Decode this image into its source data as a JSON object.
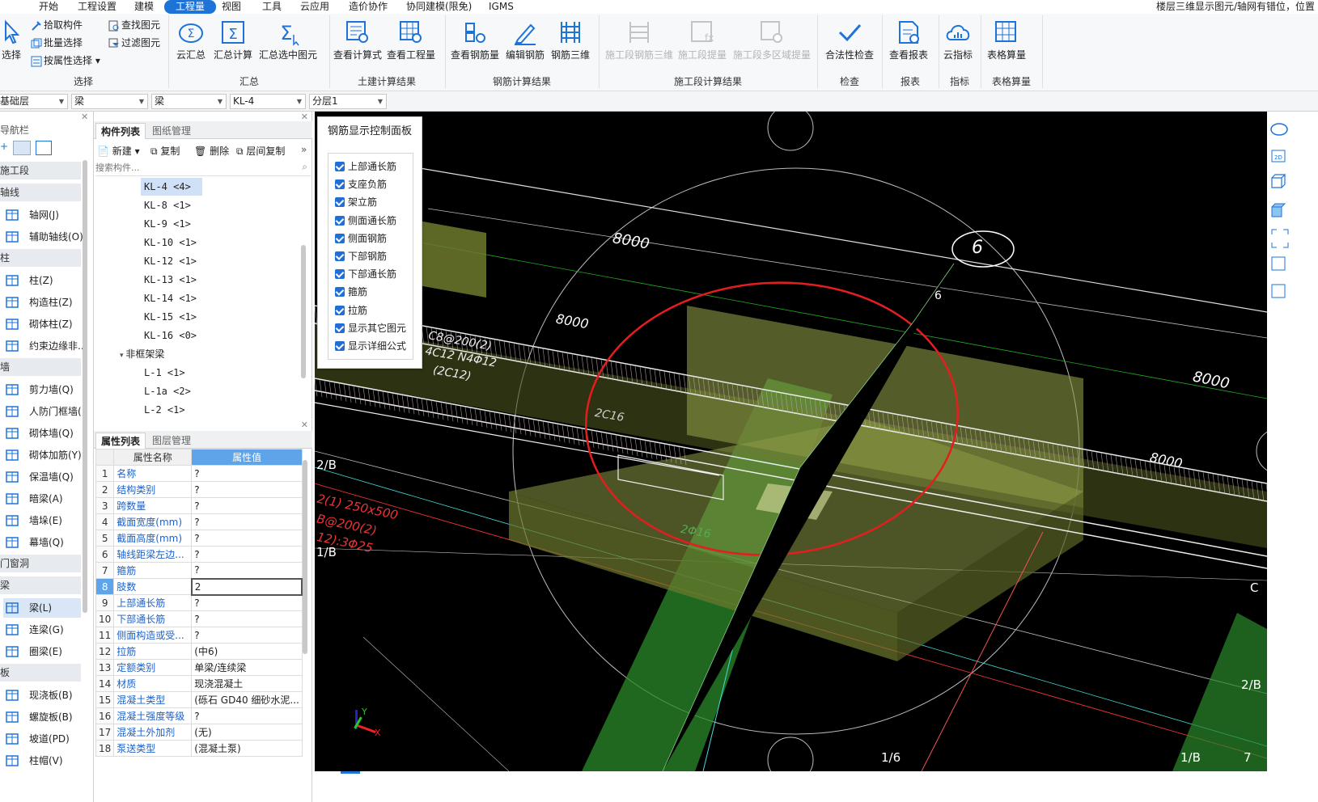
{
  "menu": {
    "items": [
      "开始",
      "工程设置",
      "建模",
      "工程量",
      "视图",
      "工具",
      "云应用",
      "造价协作",
      "协同建模(限免)",
      "IGMS"
    ],
    "active": "工程量",
    "status": "楼层三维显示图元/轴网有错位，位置"
  },
  "ribbon": {
    "select_group": {
      "label": "选择",
      "select": "选择",
      "pick": "拾取构件",
      "batch": "批量选择",
      "by_attr": "按属性选择",
      "find": "查找图元",
      "filter": "过滤图元"
    },
    "summary_group": {
      "label": "汇总",
      "cloud": "云汇总",
      "calc": "汇总计算",
      "calc_sel": "汇总选中图元"
    },
    "civil_group": {
      "label": "土建计算结果",
      "formula": "查看计算式",
      "quantity": "查看工程量"
    },
    "rebar_group": {
      "label": "钢筋计算结果",
      "view": "查看钢筋量",
      "edit": "编辑钢筋",
      "r3d": "钢筋三维"
    },
    "stage_group": {
      "label": "施工段计算结果",
      "s3d": "施工段钢筋三维",
      "sqty": "施工段提量",
      "smulti": "施工段多区域提量"
    },
    "check_group": {
      "label": "检查",
      "legal": "合法性检查"
    },
    "report_group": {
      "label": "报表",
      "view": "查看报表"
    },
    "index_group": {
      "label": "指标",
      "cloud": "云指标"
    },
    "table_group": {
      "label": "表格算量",
      "table": "表格算量"
    }
  },
  "selectors": [
    "基础层",
    "梁",
    "梁",
    "KL-4",
    "分层1"
  ],
  "nav": {
    "title": "导航栏",
    "sections": [
      {
        "type": "cat",
        "label": "施工段",
        "dot": true
      },
      {
        "type": "cat",
        "label": "轴线"
      },
      {
        "type": "item",
        "label": "轴网(J)",
        "icon": "grid-icon"
      },
      {
        "type": "item",
        "label": "辅助轴线(O)",
        "icon": "aux-axis-icon"
      },
      {
        "type": "cat",
        "label": "柱"
      },
      {
        "type": "item",
        "label": "柱(Z)",
        "icon": "column-icon"
      },
      {
        "type": "item",
        "label": "构造柱(Z)",
        "icon": "struct-column-icon"
      },
      {
        "type": "item",
        "label": "砌体柱(Z)",
        "icon": "masonry-column-icon"
      },
      {
        "type": "item",
        "label": "约束边缘非...",
        "icon": "edge-column-icon"
      },
      {
        "type": "cat",
        "label": "墙"
      },
      {
        "type": "item",
        "label": "剪力墙(Q)",
        "icon": "shear-wall-icon"
      },
      {
        "type": "item",
        "label": "人防门框墙(",
        "icon": "door-wall-icon"
      },
      {
        "type": "item",
        "label": "砌体墙(Q)",
        "icon": "masonry-wall-icon"
      },
      {
        "type": "item",
        "label": "砌体加筋(Y)",
        "icon": "wall-rebar-icon"
      },
      {
        "type": "item",
        "label": "保温墙(Q)",
        "icon": "insulation-wall-icon"
      },
      {
        "type": "item",
        "label": "暗梁(A)",
        "icon": "hidden-beam-icon"
      },
      {
        "type": "item",
        "label": "墙垛(E)",
        "icon": "wall-pier-icon"
      },
      {
        "type": "item",
        "label": "幕墙(Q)",
        "icon": "curtain-wall-icon"
      },
      {
        "type": "cat",
        "label": "门窗洞"
      },
      {
        "type": "cat",
        "label": "梁"
      },
      {
        "type": "item",
        "label": "梁(L)",
        "icon": "beam-icon",
        "active": true
      },
      {
        "type": "item",
        "label": "连梁(G)",
        "icon": "link-beam-icon"
      },
      {
        "type": "item",
        "label": "圈梁(E)",
        "icon": "ring-beam-icon"
      },
      {
        "type": "cat",
        "label": "板"
      },
      {
        "type": "item",
        "label": "现浇板(B)",
        "icon": "slab-icon"
      },
      {
        "type": "item",
        "label": "螺旋板(B)",
        "icon": "spiral-slab-icon"
      },
      {
        "type": "item",
        "label": "坡道(PD)",
        "icon": "ramp-icon"
      },
      {
        "type": "item",
        "label": "柱帽(V)",
        "icon": "column-cap-icon"
      }
    ]
  },
  "component_list": {
    "tab1": "构件列表",
    "tab2": "图纸管理",
    "new": "新建",
    "copy": "复制",
    "delete": "删除",
    "floor_copy": "层间复制",
    "search_placeholder": "搜索构件...",
    "items": [
      "KL-4 <4>",
      "KL-8 <1>",
      "KL-9 <1>",
      "KL-10 <1>",
      "KL-12 <1>",
      "KL-13 <1>",
      "KL-14 <1>",
      "KL-15 <1>",
      "KL-16 <0>"
    ],
    "group2": "非框架梁",
    "items2": [
      "L-1 <1>",
      "L-1a <2>",
      "L-2 <1>"
    ]
  },
  "properties": {
    "tab1": "属性列表",
    "tab2": "图层管理",
    "col_name": "属性名称",
    "col_value": "属性值",
    "rows": [
      [
        "1",
        "名称",
        "?"
      ],
      [
        "2",
        "结构类别",
        "?"
      ],
      [
        "3",
        "跨数量",
        "?"
      ],
      [
        "4",
        "截面宽度(mm)",
        "?"
      ],
      [
        "5",
        "截面高度(mm)",
        "?"
      ],
      [
        "6",
        "轴线距梁左边...",
        "?"
      ],
      [
        "7",
        "箍筋",
        "?"
      ],
      [
        "8",
        "肢数",
        "2"
      ],
      [
        "9",
        "上部通长筋",
        "?"
      ],
      [
        "10",
        "下部通长筋",
        "?"
      ],
      [
        "11",
        "侧面构造或受...",
        "?"
      ],
      [
        "12",
        "拉筋",
        "(中6)"
      ],
      [
        "13",
        "定额类别",
        "单梁/连续梁"
      ],
      [
        "14",
        "材质",
        "现浇混凝土"
      ],
      [
        "15",
        "混凝土类型",
        "(砾石 GD40 细砂水泥..."
      ],
      [
        "16",
        "混凝土强度等级",
        "?"
      ],
      [
        "17",
        "混凝土外加剂",
        "(无)"
      ],
      [
        "18",
        "泵送类型",
        "(混凝土泵)"
      ]
    ]
  },
  "rebar_panel": {
    "title": "钢筋显示控制面板",
    "options": [
      "上部通长筋",
      "支座负筋",
      "架立筋",
      "侧面通长筋",
      "侧面钢筋",
      "下部钢筋",
      "下部通长筋",
      "箍筋",
      "拉筋",
      "显示其它图元",
      "显示详细公式"
    ]
  },
  "viewport": {
    "dims": [
      "8000",
      "8000",
      "8000",
      "8000"
    ],
    "axis_labels": [
      "6",
      "6",
      "2/B",
      "1/B",
      "C",
      "2/B",
      "1/6",
      "1/B",
      "7"
    ],
    "annotations": [
      "2C16",
      "2Φ16",
      "2(1) 250x500",
      "B@200(2)",
      "12):3Φ25",
      "(2C12)",
      "4C12 N4Φ12",
      "C8@200(2)"
    ],
    "axes": [
      "Y",
      "X"
    ]
  }
}
